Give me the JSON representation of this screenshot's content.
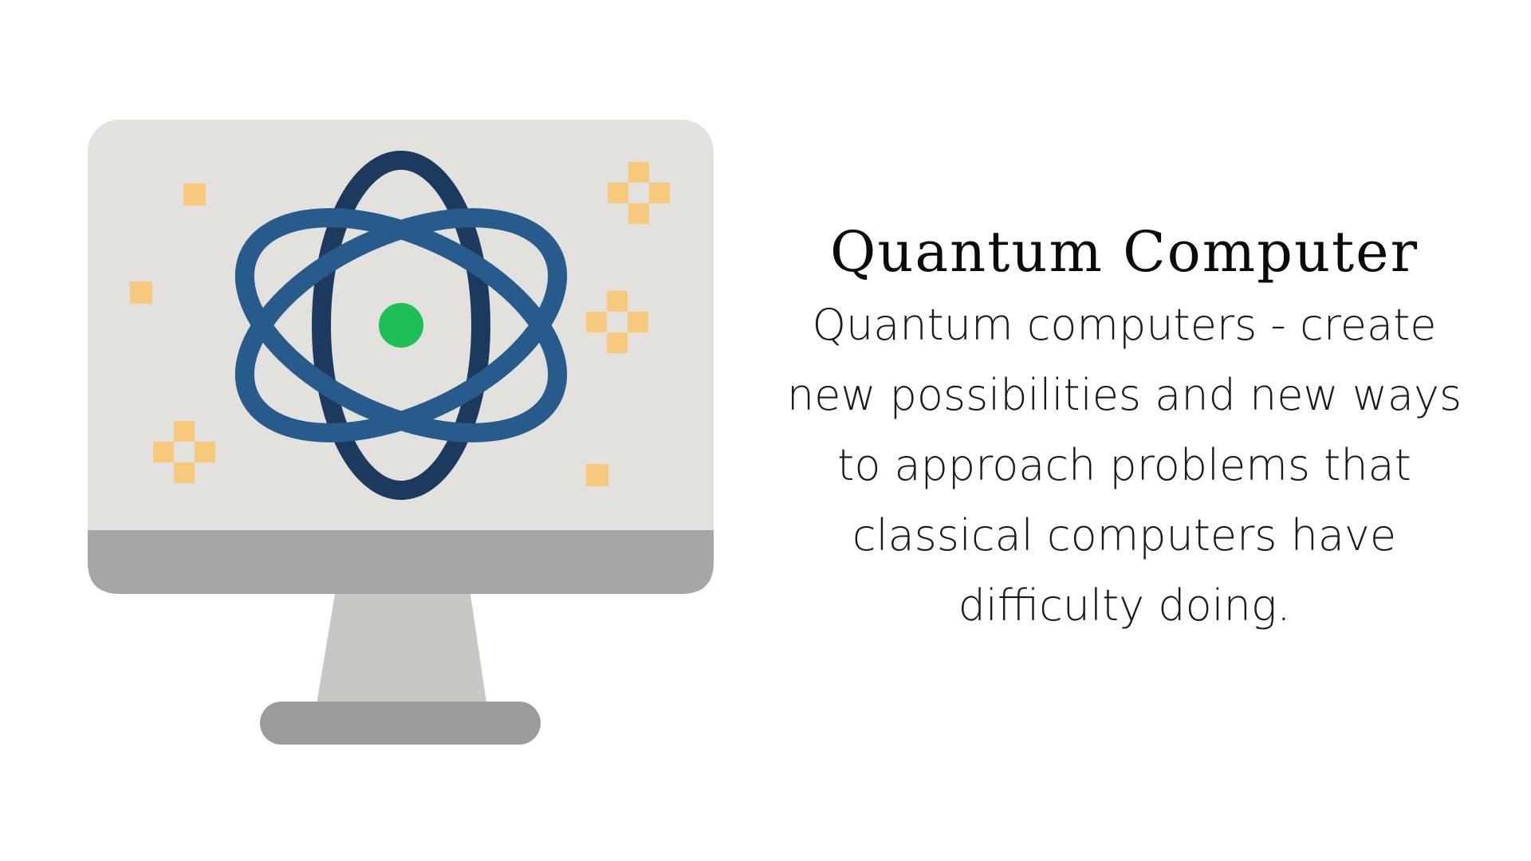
{
  "heading": {
    "title": "Quantum Computer"
  },
  "description": {
    "lines": [
      "Quantum computers - create",
      "new possibilities and new ways",
      "to approach problems that",
      "classical computers have",
      "difficulty doing."
    ]
  },
  "illustration": {
    "icon": "quantum-computer-monitor-icon",
    "colors": {
      "screen": "#e3e1dd",
      "bezel": "#a6a6a5",
      "stand": "#c9c7c3",
      "base": "#9b9b9a",
      "orbit_dark": "#1b3a5e",
      "orbit_light": "#275b8c",
      "nucleus": "#1dbf56",
      "sparkle": "#f6c97c"
    }
  }
}
